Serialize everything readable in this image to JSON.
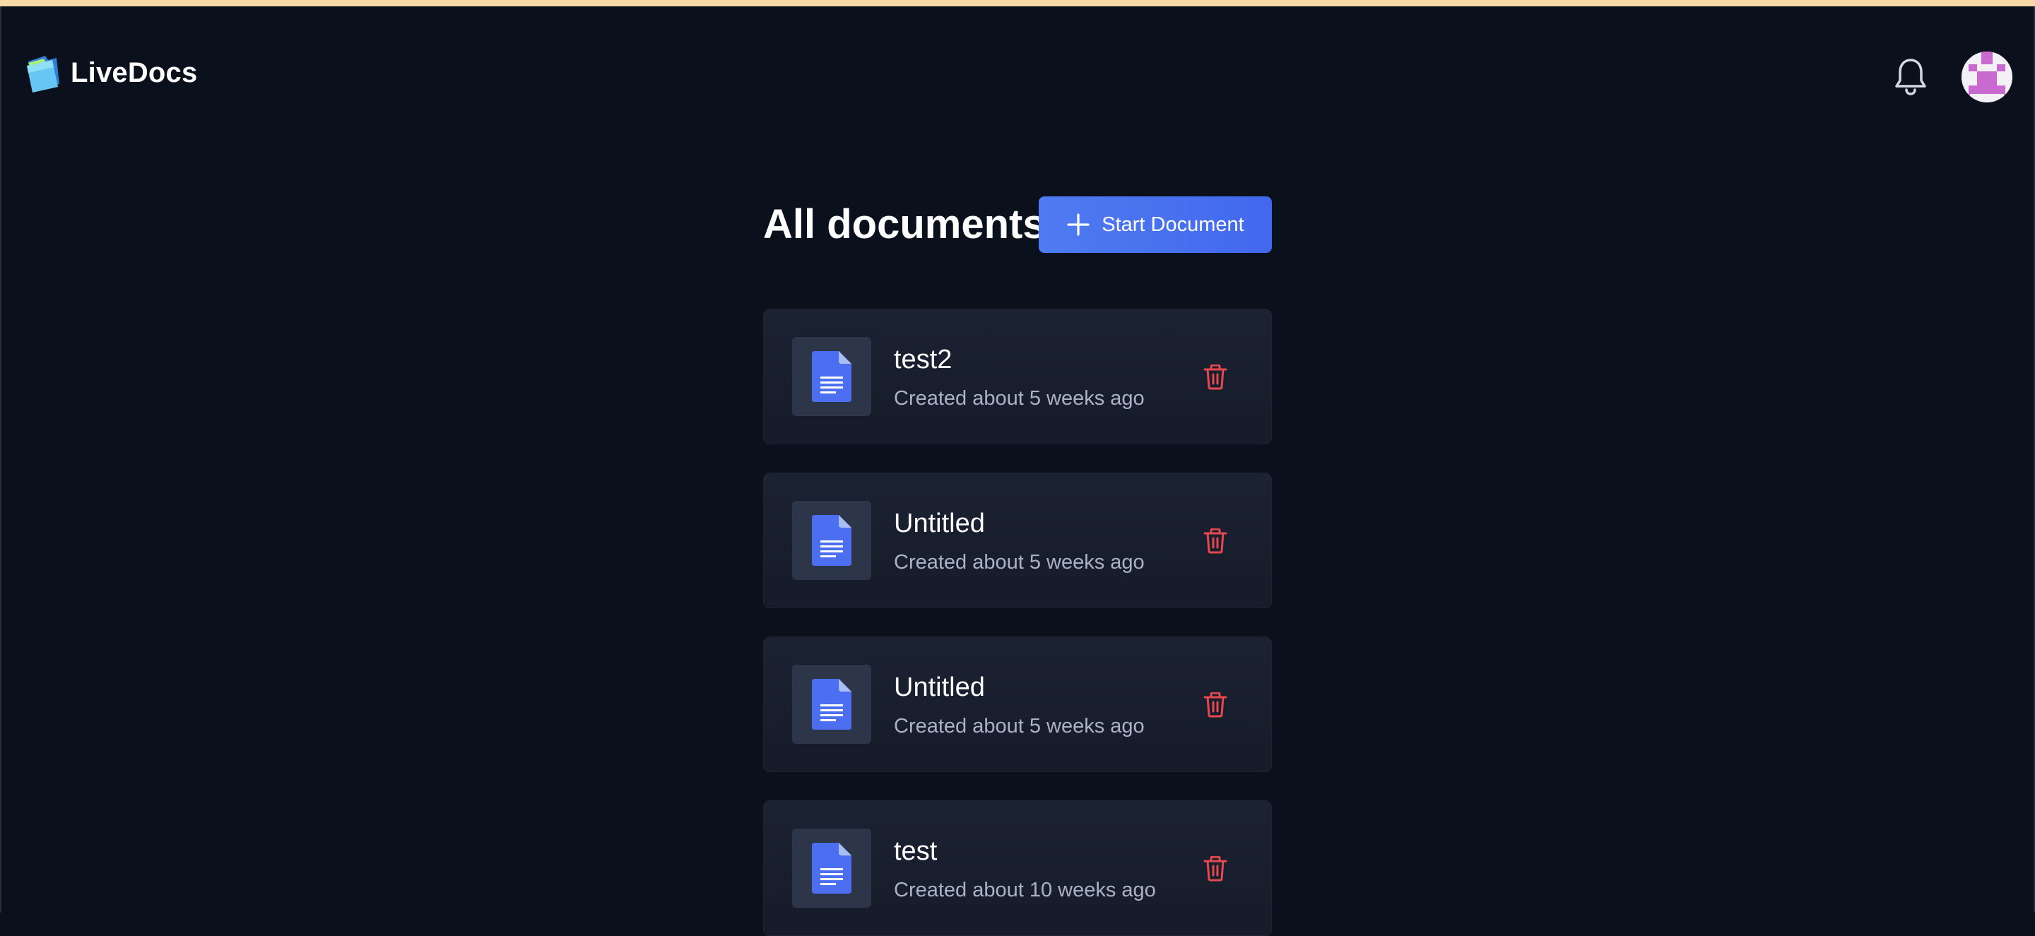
{
  "app": {
    "name": "LiveDocs"
  },
  "header": {
    "notifications_icon": "bell-icon",
    "avatar_icon": "user-avatar"
  },
  "main": {
    "title": "All documents",
    "start_button_label": "Start Document",
    "documents": [
      {
        "title": "test2",
        "created": "Created about 5 weeks ago"
      },
      {
        "title": "Untitled",
        "created": "Created about 5 weeks ago"
      },
      {
        "title": "Untitled",
        "created": "Created about 5 weeks ago"
      },
      {
        "title": "test",
        "created": "Created about 10 weeks ago"
      }
    ]
  },
  "colors": {
    "background": "#0b101d",
    "accent": "#4470ef",
    "danger": "#e5484d",
    "doc_icon": "#4b6ff0",
    "top_strip": "#f9d9a8"
  }
}
